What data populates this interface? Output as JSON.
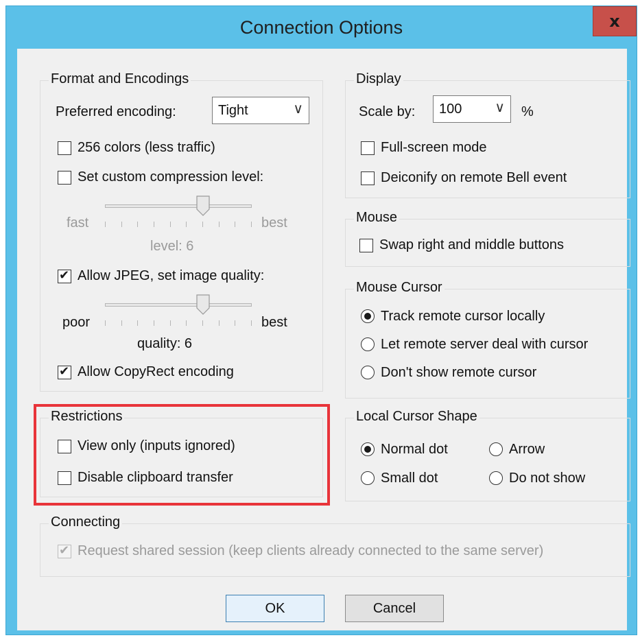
{
  "window": {
    "title": "Connection Options",
    "close_glyph": "x"
  },
  "format": {
    "label": "Format and Encodings",
    "preferred_encoding_label": "Preferred encoding:",
    "encoding_value": "Tight",
    "colors256": {
      "label": "256 colors (less traffic)",
      "checked": false
    },
    "custom_compression": {
      "label": "Set custom compression level:",
      "checked": false
    },
    "compression_slider": {
      "left_label": "fast",
      "right_label": "best",
      "level_text": "level: 6",
      "value": 6,
      "min": 0,
      "max": 9,
      "enabled": false
    },
    "allow_jpeg": {
      "label": "Allow JPEG, set image quality:",
      "checked": true
    },
    "quality_slider": {
      "left_label": "poor",
      "right_label": "best",
      "quality_text": "quality: 6",
      "value": 6,
      "min": 0,
      "max": 9,
      "enabled": false
    },
    "copyrect": {
      "label": "Allow CopyRect encoding",
      "checked": true
    }
  },
  "display": {
    "label": "Display",
    "scale_label": "Scale by:",
    "scale_value": "100",
    "scale_unit": "%",
    "fullscreen": {
      "label": "Full-screen mode",
      "checked": false
    },
    "deiconify": {
      "label": "Deiconify on remote Bell event",
      "checked": false
    }
  },
  "mouse": {
    "label": "Mouse",
    "swap": {
      "label": "Swap right and middle buttons",
      "checked": false
    }
  },
  "mouse_cursor": {
    "label": "Mouse Cursor",
    "options": [
      {
        "label": "Track remote cursor locally",
        "checked": true
      },
      {
        "label": "Let remote server deal with cursor",
        "checked": false
      },
      {
        "label": "Don't show remote cursor",
        "checked": false
      }
    ]
  },
  "restrictions": {
    "label": "Restrictions",
    "view_only": {
      "label": "View only (inputs ignored)",
      "checked": false
    },
    "disable_clipboard": {
      "label": "Disable clipboard transfer",
      "checked": false
    }
  },
  "local_cursor": {
    "label": "Local Cursor Shape",
    "options": [
      {
        "label": "Normal dot",
        "checked": true
      },
      {
        "label": "Arrow",
        "checked": false
      },
      {
        "label": "Small dot",
        "checked": false
      },
      {
        "label": "Do not show",
        "checked": false
      }
    ]
  },
  "connecting": {
    "label": "Connecting",
    "shared": {
      "label": "Request shared session (keep clients already connected to the same server)",
      "checked": true,
      "enabled": false
    }
  },
  "buttons": {
    "ok": "OK",
    "cancel": "Cancel"
  },
  "colors": {
    "title_bar": "#5bc0e8",
    "close_button": "#c7504a",
    "highlight": "#e8343a",
    "dialog_bg": "#f0f0f0"
  }
}
